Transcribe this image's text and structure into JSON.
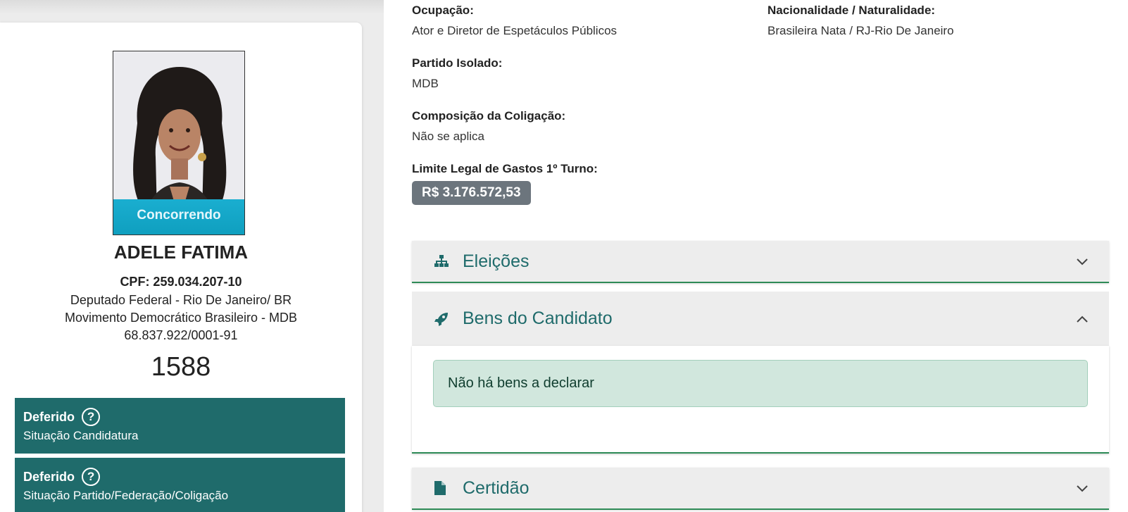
{
  "candidate": {
    "status_ribbon": "Concorrendo",
    "name": "ADELE FATIMA",
    "cpf": "CPF: 259.034.207-10",
    "office": "Deputado Federal - Rio De Janeiro/ BR",
    "party": "Movimento Democrático Brasileiro - MDB",
    "cnpj": "68.837.922/0001-91",
    "number": "1588"
  },
  "situations": [
    {
      "title": "Deferido",
      "subtitle": "Situação Candidatura"
    },
    {
      "title": "Deferido",
      "subtitle": "Situação Partido/Federação/Coligação"
    }
  ],
  "details": {
    "occupation_label": "Ocupação:",
    "occupation_value": "Ator e Diretor de Espetáculos Públicos",
    "nationality_label": "Nacionalidade / Naturalidade:",
    "nationality_value": "Brasileira Nata / RJ-Rio De Janeiro",
    "party_label": "Partido Isolado:",
    "party_value": "MDB",
    "coalition_label": "Composição da Coligação:",
    "coalition_value": "Não se aplica",
    "spend_label": "Limite Legal de Gastos 1º Turno:",
    "spend_value": "R$ 3.176.572,53"
  },
  "accordion": {
    "elections_label": "Eleições",
    "assets_label": "Bens do Candidato",
    "assets_message": "Não há bens a declarar",
    "certificate_label": "Certidão"
  },
  "icons": {
    "elections": "sitemap-icon",
    "assets": "rocket-icon",
    "certificate": "file-icon",
    "help": "question-circle-icon"
  },
  "colors": {
    "accent": "#1f6b6b",
    "ribbon": "#17a2b8",
    "badge": "#6c757d",
    "alert_bg": "#d1e7dd"
  }
}
